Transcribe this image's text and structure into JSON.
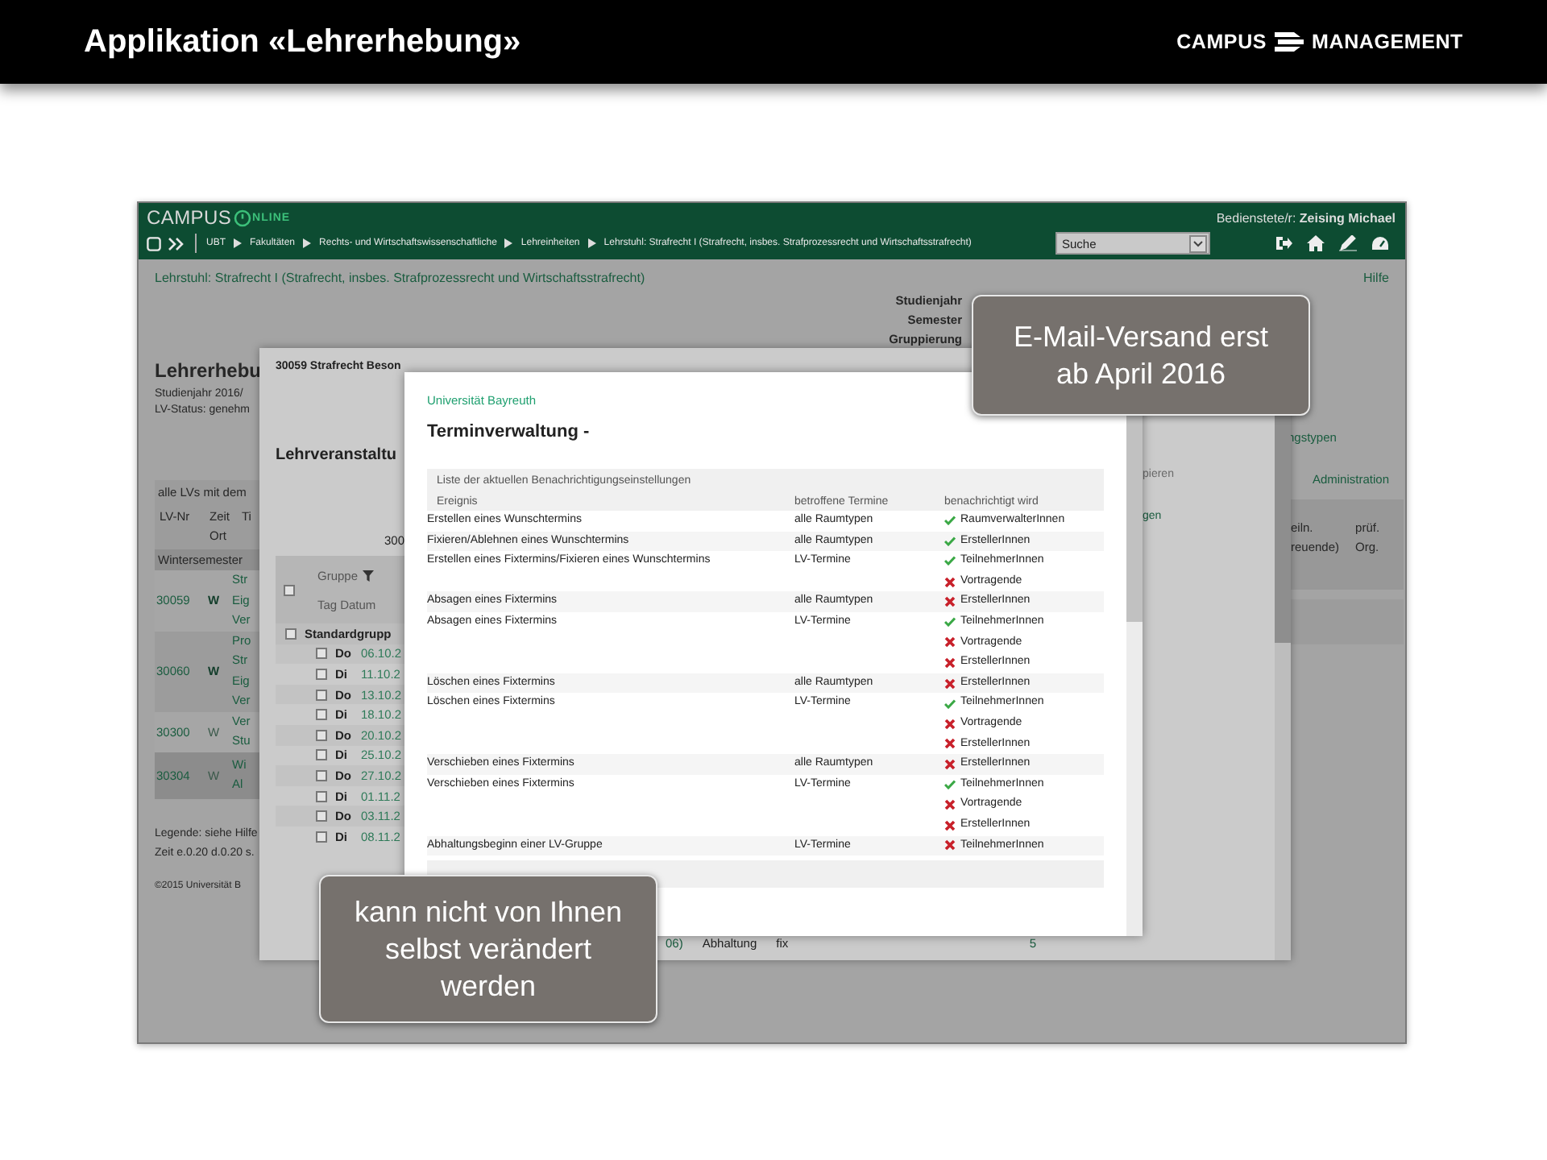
{
  "slide": {
    "title": "Applikation «Lehrerhebung»",
    "brand": [
      "CAMPUS",
      "MANAGEMENT"
    ]
  },
  "app_header": {
    "logo": {
      "word": "CAMPUS",
      "suffix": "NLINE"
    },
    "user": "Bedienstete/r: **Zeising Michael**",
    "breadcrumbs": [
      "UBT",
      "Fakultäten",
      "Rechts- und Wirtschaftswissenschaftliche",
      "Lehreinheiten",
      "Lehrstuhl: Strafrecht I (Strafrecht, insbes. Strafprozessrecht und Wirtschaftsstrafrecht)"
    ],
    "search_select": "Suche"
  },
  "page": {
    "heading": "Lehrstuhl: Strafrecht I (Strafrecht, insbes. Strafprozessrecht und Wirtschaftsstrafrecht)",
    "help_link": "Hilfe",
    "filters": [
      "Studienjahr",
      "Semester",
      "Gruppierung"
    ],
    "title": "Lehrerhebu",
    "meta": [
      "Studienjahr 2016/",
      "LV-Status: genehm"
    ],
    "table": {
      "caption": "alle LVs mit dem",
      "columns": [
        {
          "lines": [
            "LV-Nr"
          ]
        },
        {
          "lines": [
            "Zeit",
            "Ort"
          ]
        },
        {
          "lines": [
            "Ti"
          ]
        }
      ],
      "section": "Wintersemester",
      "rows": [
        {
          "number": "30059",
          "week_type": "W",
          "emphasized": true,
          "highlighted": false,
          "lines": [
            "Str",
            "Eig",
            "Ver"
          ]
        },
        {
          "number": "30060",
          "week_type": "W",
          "emphasized": true,
          "highlighted": false,
          "lines": [
            "Pro",
            "Str",
            "Eig",
            "Ver"
          ]
        },
        {
          "number": "30300",
          "week_type": "W",
          "emphasized": false,
          "highlighted": false,
          "lines": [
            "Ver",
            "Stu"
          ]
        },
        {
          "number": "30304",
          "week_type": "W",
          "emphasized": false,
          "highlighted": true,
          "lines": [
            "Wi",
            "Al"
          ]
        }
      ]
    },
    "legend": "Legende: siehe Hilfe",
    "timing": "Zeit e.0.20 d.0.20 s.",
    "copyright": "©2015 Universität B",
    "right_links": [
      "ngstypen",
      "Administration"
    ],
    "right_columns": [
      {
        "lines": [
          "eiln.",
          "reuende)"
        ]
      },
      {
        "lines": [
          "prüf.",
          "Org."
        ]
      }
    ]
  },
  "course_dialog": {
    "title": "30059 Strafrecht Beson",
    "heading": "Lehrveranstaltu",
    "number": "300",
    "side_texts": [
      {
        "text": "pieren",
        "link": false
      },
      {
        "text": "gen",
        "link": true
      }
    ],
    "group_table": {
      "column_group": "Gruppe",
      "column_day": "Tag",
      "column_date": "Datum",
      "checked": false,
      "group": {
        "name": "Standardgrupp",
        "checked": false
      },
      "rows": [
        {
          "day": "Do",
          "date": "06.10.2",
          "checked": false
        },
        {
          "day": "Di",
          "date": "11.10.2",
          "checked": false
        },
        {
          "day": "Do",
          "date": "13.10.2",
          "checked": false
        },
        {
          "day": "Di",
          "date": "18.10.2",
          "checked": false
        },
        {
          "day": "Do",
          "date": "20.10.2",
          "checked": false
        },
        {
          "day": "Di",
          "date": "25.10.2",
          "checked": false
        },
        {
          "day": "Do",
          "date": "27.10.2",
          "checked": false
        },
        {
          "day": "Di",
          "date": "01.11.2",
          "checked": false
        },
        {
          "day": "Do",
          "date": "03.11.2",
          "checked": false
        },
        {
          "day": "Di",
          "date": "08.11.2",
          "checked": false
        }
      ]
    },
    "bottom_row": {
      "date": "06)",
      "type": "Abhaltung",
      "status": "fix",
      "count": "5"
    }
  },
  "schedule_dialog": {
    "university": "Universität Bayreuth",
    "title": "Terminverwaltung -",
    "table": {
      "caption": "Liste der aktuellen Benachrichtigungseinstellungen",
      "columns": [
        "Ereignis",
        "betroffene Termine",
        "benachrichtigt wird"
      ],
      "rows": [
        {
          "event": "Erstellen eines Wunschtermins",
          "scope": "alle Raumtypen",
          "recipients": [
            {
              "name": "RaumverwalterInnen",
              "notified": true
            }
          ]
        },
        {
          "event": "Fixieren/Ablehnen eines Wunschtermins",
          "scope": "alle Raumtypen",
          "recipients": [
            {
              "name": "ErstellerInnen",
              "notified": true
            }
          ]
        },
        {
          "event": "Erstellen eines Fixtermins/Fixieren eines Wunschtermins",
          "scope": "LV-Termine",
          "recipients": [
            {
              "name": "TeilnehmerInnen",
              "notified": true
            },
            {
              "name": "Vortragende",
              "notified": false
            }
          ]
        },
        {
          "event": "Absagen eines Fixtermins",
          "scope": "alle Raumtypen",
          "recipients": [
            {
              "name": "ErstellerInnen",
              "notified": false
            }
          ]
        },
        {
          "event": "Absagen eines Fixtermins",
          "scope": "LV-Termine",
          "recipients": [
            {
              "name": "TeilnehmerInnen",
              "notified": true
            },
            {
              "name": "Vortragende",
              "notified": false
            },
            {
              "name": "ErstellerInnen",
              "notified": false
            }
          ]
        },
        {
          "event": "Löschen eines Fixtermins",
          "scope": "alle Raumtypen",
          "recipients": [
            {
              "name": "ErstellerInnen",
              "notified": false
            }
          ]
        },
        {
          "event": "Löschen eines Fixtermins",
          "scope": "LV-Termine",
          "recipients": [
            {
              "name": "TeilnehmerInnen",
              "notified": true
            },
            {
              "name": "Vortragende",
              "notified": false
            },
            {
              "name": "ErstellerInnen",
              "notified": false
            }
          ]
        },
        {
          "event": "Verschieben eines Fixtermins",
          "scope": "alle Raumtypen",
          "recipients": [
            {
              "name": "ErstellerInnen",
              "notified": false
            }
          ]
        },
        {
          "event": "Verschieben eines Fixtermins",
          "scope": "LV-Termine",
          "recipients": [
            {
              "name": "TeilnehmerInnen",
              "notified": true
            },
            {
              "name": "Vortragende",
              "notified": false
            },
            {
              "name": "ErstellerInnen",
              "notified": false
            }
          ]
        },
        {
          "event": "Abhaltungsbeginn einer LV-Gruppe",
          "scope": "LV-Termine",
          "recipients": [
            {
              "name": "TeilnehmerInnen",
              "notified": false
            }
          ]
        }
      ]
    }
  },
  "callouts": [
    "E-Mail-Versand erst ab April 2016",
    "kann nicht von Ihnen selbst verändert werden"
  ]
}
